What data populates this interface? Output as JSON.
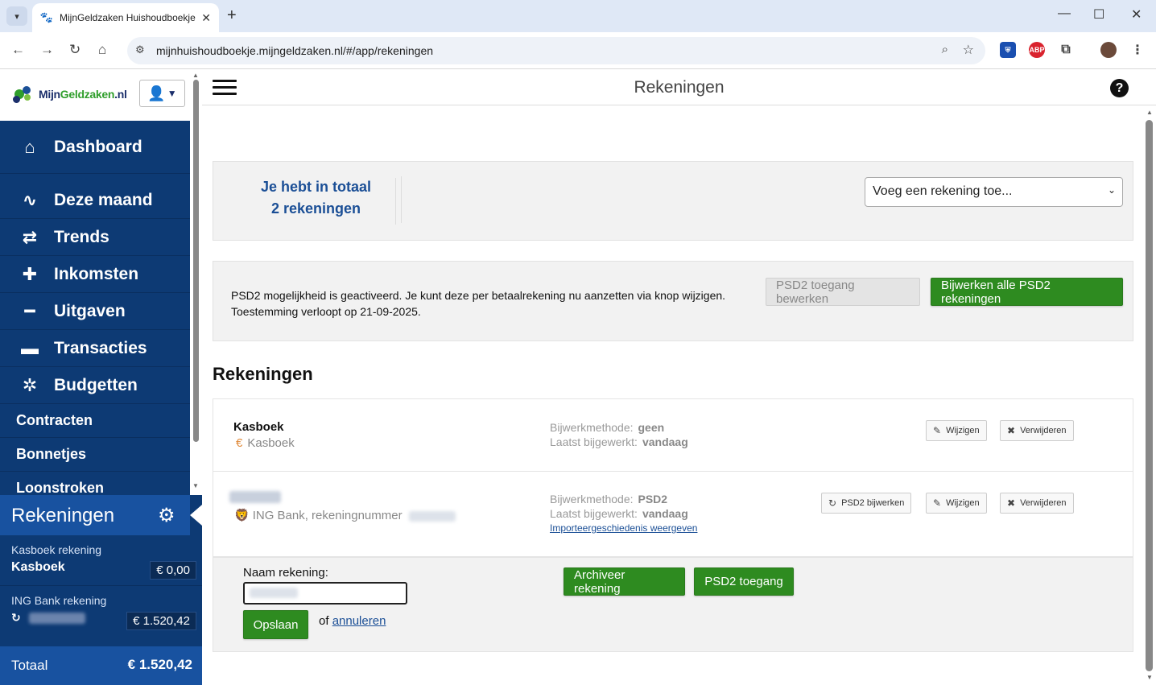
{
  "browser": {
    "tab_title": "MijnGeldzaken Huishoudboekje",
    "url": "mijnhuishoudboekje.mijngeldzaken.nl/#/app/rekeningen",
    "ext_abp": "ABP"
  },
  "sidebar": {
    "logo_text_a": "Mijn",
    "logo_text_b": "Geldzaken",
    "logo_text_c": ".nl",
    "menu": [
      {
        "label": "Dashboard",
        "icon": "home-icon"
      },
      {
        "label": "Deze maand",
        "icon": "pulse-icon"
      },
      {
        "label": "Trends",
        "icon": "shuffle-icon"
      },
      {
        "label": "Inkomsten",
        "icon": "plus-icon"
      },
      {
        "label": "Uitgaven",
        "icon": "minus-icon"
      },
      {
        "label": "Transacties",
        "icon": "credit-card-icon"
      },
      {
        "label": "Budgetten",
        "icon": "budget-icon"
      },
      {
        "label": "Contracten"
      },
      {
        "label": "Bonnetjes"
      },
      {
        "label": "Loonstroken"
      }
    ],
    "accounts": {
      "title": "Rekeningen",
      "items": [
        {
          "label": "Kasboek rekening",
          "name": "Kasboek",
          "balance": "€ 0,00"
        },
        {
          "label": "ING Bank rekening",
          "name": "",
          "balance": "€ 1.520,42"
        }
      ],
      "total_label": "Totaal",
      "total_amount": "€ 1.520,42"
    }
  },
  "main": {
    "title": "Rekeningen",
    "summary_line1": "Je hebt in totaal",
    "summary_line2": "2 rekeningen",
    "add_select": "Voeg een rekening toe...",
    "psd2_line1": "PSD2 mogelijkheid is geactiveerd. Je kunt deze per betaalrekening nu aanzetten via knop wijzigen.",
    "psd2_line2": "Toestemming verloopt op 21-09-2025.",
    "psd2_edit_btn": "PSD2 toegang bewerken",
    "psd2_update_all_btn": "Bijwerken alle PSD2 rekeningen",
    "section_heading": "Rekeningen",
    "accounts": [
      {
        "name": "Kasboek",
        "sub": "Kasboek",
        "method_label": "Bijwerkmethode:",
        "method": "geen",
        "updated_label": "Laatst bijgewerkt:",
        "updated": "vandaag"
      },
      {
        "name": "",
        "sub": "ING Bank, rekeningnummer",
        "method_label": "Bijwerkmethode:",
        "method": "PSD2",
        "updated_label": "Laatst bijgewerkt:",
        "updated": "vandaag",
        "history_link": "Importeergeschiedenis weergeven"
      }
    ],
    "btn_psd2_update": "PSD2 bijwerken",
    "btn_edit": "Wijzigen",
    "btn_delete": "Verwijderen",
    "edit_form": {
      "name_label": "Naam rekening:",
      "archive_btn": "Archiveer rekening",
      "psd2_btn": "PSD2 toegang",
      "save_btn": "Opslaan",
      "or_text": "of",
      "cancel_link": "annuleren"
    }
  },
  "colors": {
    "sidebar_bg": "#0d3a74",
    "accent_blue": "#1852a0",
    "green": "#2e8b20"
  }
}
